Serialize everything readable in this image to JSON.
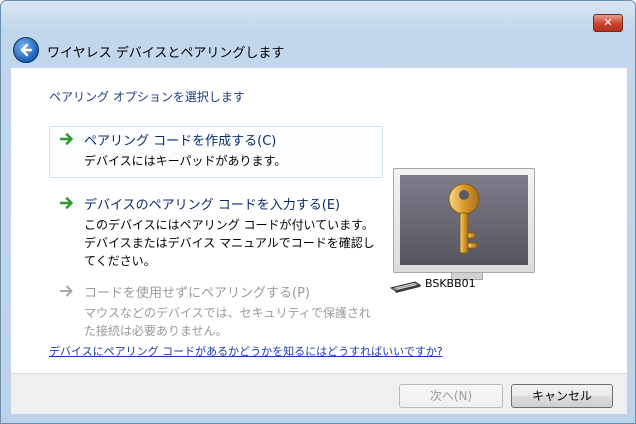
{
  "window": {
    "close_label": "✕"
  },
  "header": {
    "title": "ワイヤレス デバイスとペアリングします"
  },
  "instruction": "ペアリング オプションを選択します",
  "options": [
    {
      "title": "ペアリング コードを作成する(C)",
      "desc": "デバイスにはキーパッドがあります。",
      "state": "hover",
      "arrow_color": "#2c9a2c"
    },
    {
      "title": "デバイスのペアリング コードを入力する(E)",
      "desc": "このデバイスにはペアリング コードが付いています。\nデバイスまたはデバイス マニュアルでコードを確認し\nてください。",
      "state": "normal",
      "arrow_color": "#2c9a2c"
    },
    {
      "title": "コードを使用せずにペアリングする(P)",
      "desc": "マウスなどのデバイスでは、セキュリティで保護され\nた接続は必要ありません。",
      "state": "disabled",
      "arrow_color": "#a8a8a8"
    }
  ],
  "help_link": "デバイスにペアリング コードがあるかどうかを知るにはどうすればいいですか?",
  "device": {
    "name": "BSKBB01",
    "icon": "keyboard-icon",
    "image": "key-icon"
  },
  "footer": {
    "next_label": "次へ(N)",
    "cancel_label": "キャンセル"
  }
}
